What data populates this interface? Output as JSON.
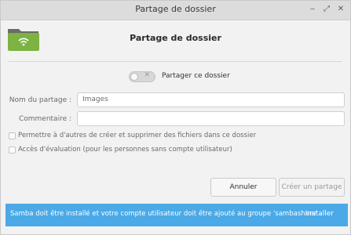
{
  "window": {
    "title": "Partage de dossier",
    "controls": {
      "minimize": "‒",
      "maximize": "⤢",
      "close": "✕"
    }
  },
  "header": {
    "title": "Partage de dossier",
    "icon": "folder-network-icon",
    "accent": "#77b255"
  },
  "share_toggle": {
    "label": "Partager ce dossier",
    "on": false,
    "off_mark": "✕"
  },
  "form": {
    "share_name": {
      "label": "Nom du partage :",
      "value": "Images"
    },
    "comment": {
      "label": "Commentaire :",
      "value": ""
    },
    "allow_others": {
      "label": "Permettre à d'autres de créer et supprimer des fichiers dans ce dossier",
      "checked": false
    },
    "guest_access": {
      "label": "Accès d'évaluation  (pour les personnes sans compte utilisateur)",
      "checked": false
    }
  },
  "buttons": {
    "cancel": "Annuler",
    "create": "Créer un partage"
  },
  "info_bar": {
    "message": "Samba doit être installé et votre compte utilisateur doit être ajouté au groupe 'sambashare' .",
    "action": "Installer",
    "color": "#4aa9e6"
  }
}
